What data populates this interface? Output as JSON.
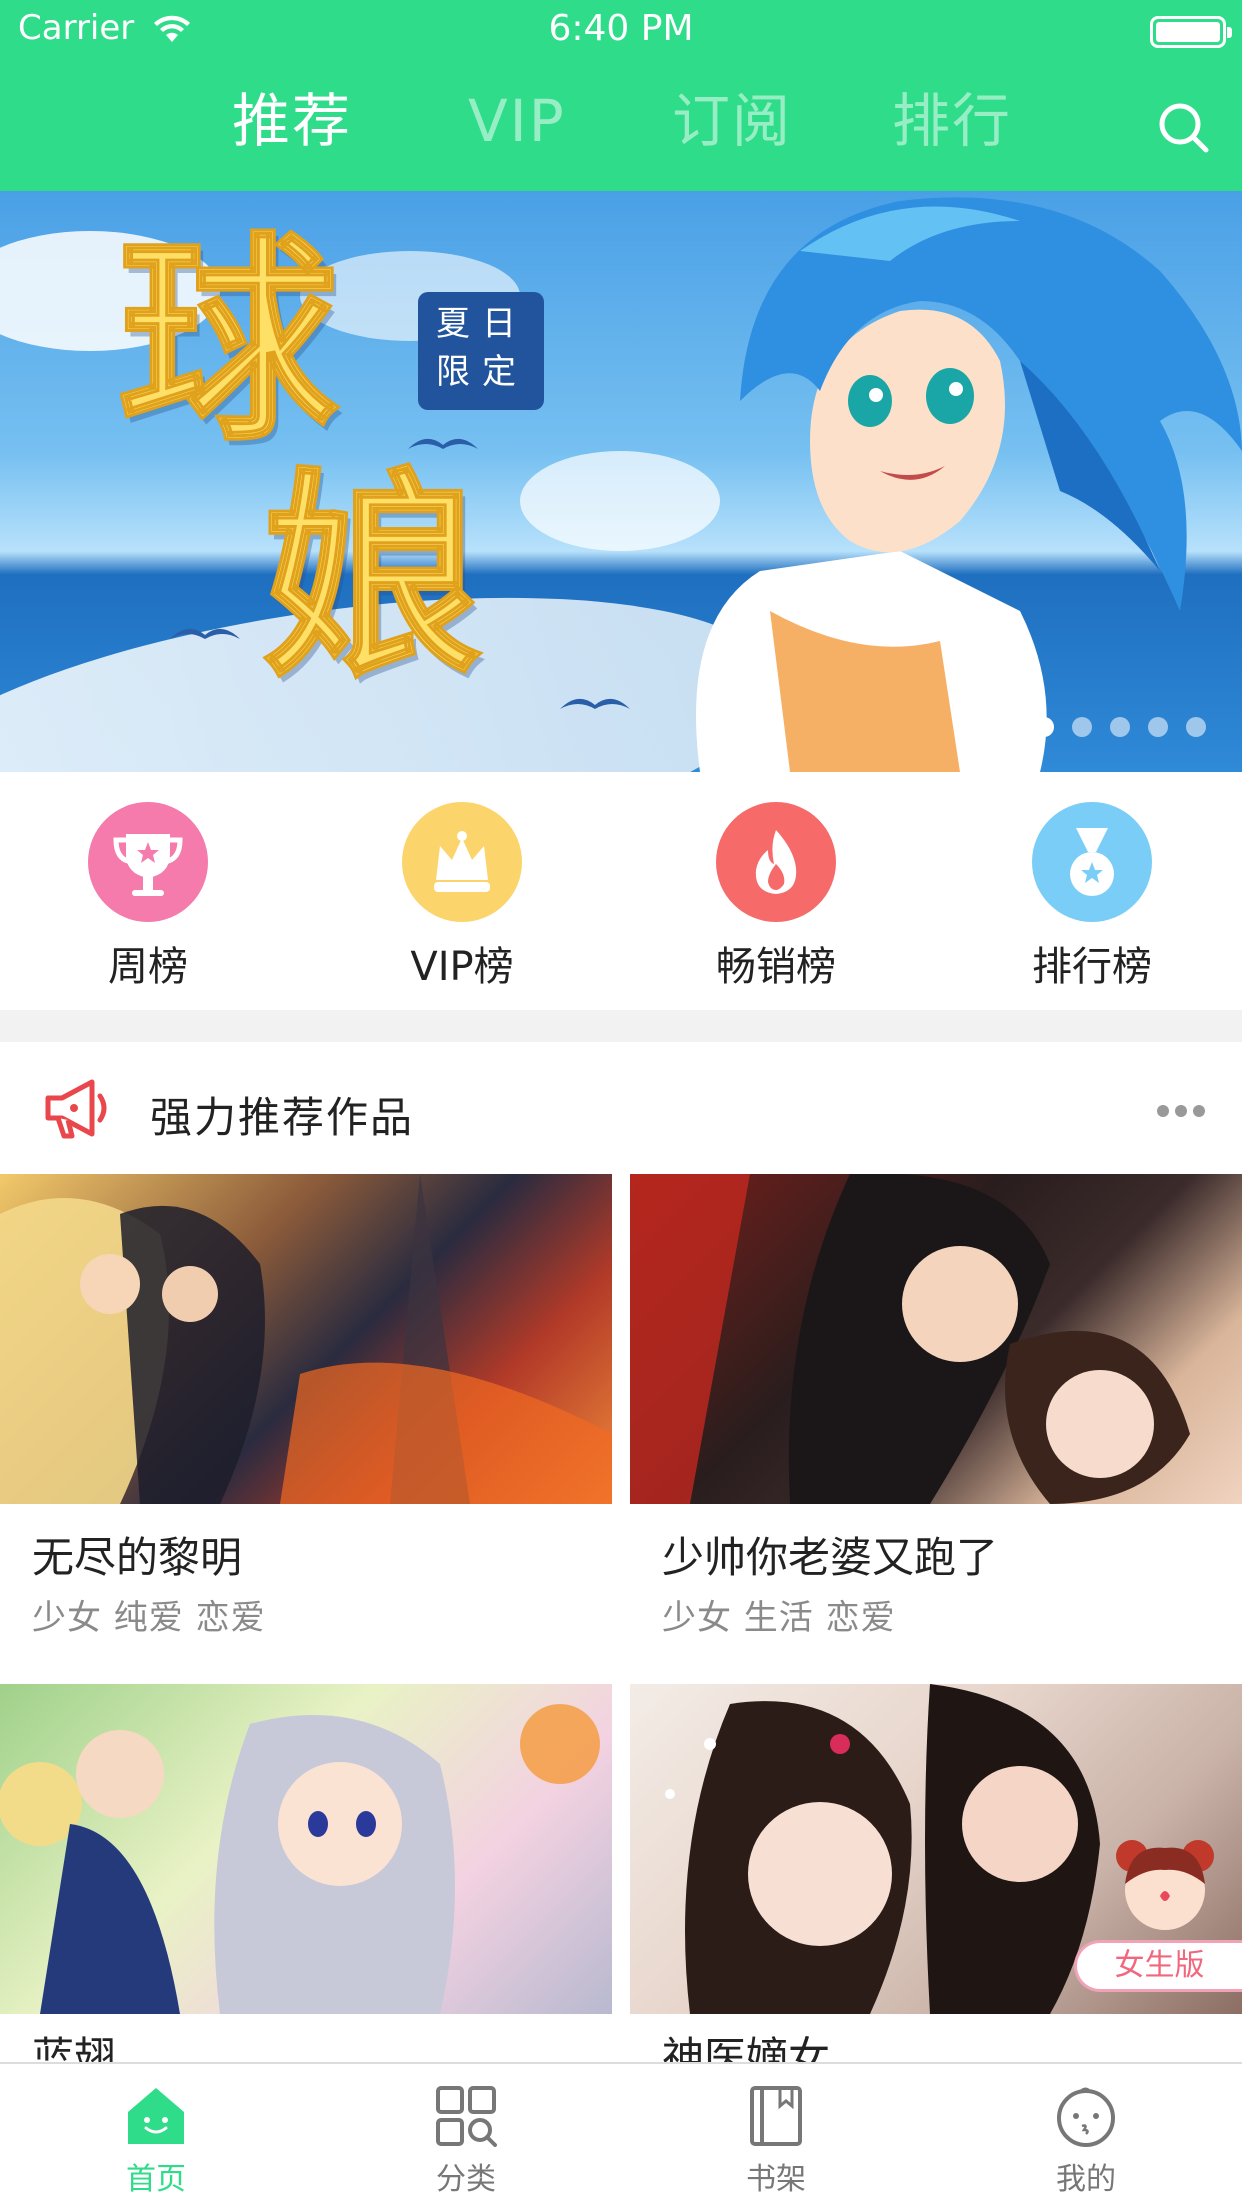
{
  "status_bar": {
    "carrier": "Carrier",
    "time": "6:40 PM"
  },
  "nav": {
    "tabs": [
      {
        "label": "推荐",
        "active": true
      },
      {
        "label": "VIP",
        "active": false
      },
      {
        "label": "订阅",
        "active": false
      },
      {
        "label": "排行",
        "active": false
      }
    ],
    "search_icon": "search-icon",
    "accent_color": "#2fdc8a"
  },
  "banner": {
    "title_line1": "球",
    "title_line2": "娘",
    "badge_line1": "夏日",
    "badge_line2": "限定",
    "page_count": 5,
    "active_page": 1
  },
  "ranks": [
    {
      "label": "周榜",
      "icon": "trophy-icon",
      "color": "#f47bab"
    },
    {
      "label": "VIP榜",
      "icon": "crown-icon",
      "color": "#fbd46b"
    },
    {
      "label": "畅销榜",
      "icon": "flame-icon",
      "color": "#f66a6a"
    },
    {
      "label": "排行榜",
      "icon": "medal-icon",
      "color": "#79cdf6"
    }
  ],
  "section": {
    "title": "强力推荐作品",
    "icon": "megaphone-icon",
    "more_icon": "more-dots-icon"
  },
  "cards": [
    {
      "title": "无尽的黎明",
      "tags": "少女 纯爱 恋爱"
    },
    {
      "title": "少帅你老婆又跑了",
      "tags": "少女 生活 恋爱"
    },
    {
      "title": "蓝翅",
      "tags": ""
    },
    {
      "title": "神医嫡女",
      "tags": "",
      "badge": "女生版"
    }
  ],
  "tabbar": [
    {
      "label": "首页",
      "icon": "home-icon",
      "active": true
    },
    {
      "label": "分类",
      "icon": "category-icon",
      "active": false
    },
    {
      "label": "书架",
      "icon": "bookshelf-icon",
      "active": false
    },
    {
      "label": "我的",
      "icon": "profile-icon",
      "active": false
    }
  ]
}
